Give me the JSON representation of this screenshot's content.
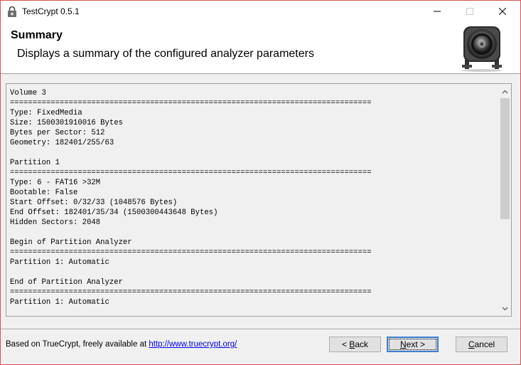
{
  "window": {
    "title": "TestCrypt 0.5.1"
  },
  "header": {
    "title": "Summary",
    "subtitle": "Displays a summary of the configured analyzer parameters",
    "logo_icon": "camera-lens-logo-icon"
  },
  "summary": {
    "lines": [
      "Volume 3",
      "================================================================================",
      "Type: FixedMedia",
      "Size: 1500301910016 Bytes",
      "Bytes per Sector: 512",
      "Geometry: 182401/255/63",
      "",
      "Partition 1",
      "================================================================================",
      "Type: 6 - FAT16 >32M",
      "Bootable: False",
      "Start Offset: 0/32/33 (1048576 Bytes)",
      "End Offset: 182401/35/34 (1500300443648 Bytes)",
      "Hidden Sectors: 2048",
      "",
      "Begin of Partition Analyzer",
      "================================================================================",
      "Partition 1: Automatic",
      "",
      "End of Partition Analyzer",
      "================================================================================",
      "Partition 1: Automatic"
    ]
  },
  "footer": {
    "text": "Based on TrueCrypt, freely available at ",
    "link": "http://www.truecrypt.org/"
  },
  "buttons": {
    "back_prefix": "< ",
    "back_accel": "B",
    "back_rest": "ack",
    "next_accel": "N",
    "next_rest": "ext >",
    "cancel_accel": "C",
    "cancel_rest": "ancel"
  },
  "colors": {
    "accent_border": "#d9534f",
    "focus": "#3c7fd3",
    "link": "#0000ee"
  }
}
